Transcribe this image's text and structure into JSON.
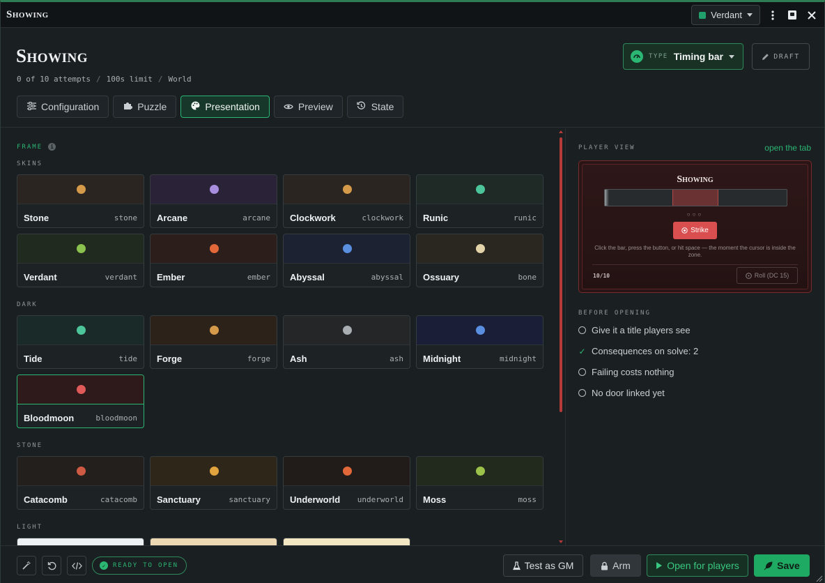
{
  "window": {
    "title": "Showing"
  },
  "theme_select": {
    "value": "Verdant",
    "swatch_color": "#22a06b"
  },
  "header": {
    "title": "Showing",
    "meta": {
      "attempts": "0 of 10 attempts",
      "limit": "100s limit",
      "scope": "World"
    },
    "type": {
      "label": "TYPE",
      "value": "Timing bar"
    },
    "draft_label": "DRAFT"
  },
  "tabs": [
    {
      "label": "Configuration",
      "icon": "sliders-icon"
    },
    {
      "label": "Puzzle",
      "icon": "puzzle-icon"
    },
    {
      "label": "Presentation",
      "icon": "palette-icon",
      "active": true
    },
    {
      "label": "Preview",
      "icon": "eye-icon"
    },
    {
      "label": "State",
      "icon": "history-icon"
    }
  ],
  "frame": {
    "label": "FRAME",
    "groups": [
      {
        "label": "SKINS",
        "items": [
          {
            "name": "Stone",
            "code": "stone",
            "bg": "#2a2520",
            "dot": "#d49a4a"
          },
          {
            "name": "Arcane",
            "code": "arcane",
            "bg": "#2a2236",
            "dot": "#a98ee0"
          },
          {
            "name": "Clockwork",
            "code": "clockwork",
            "bg": "#2a2520",
            "dot": "#d49a4a"
          },
          {
            "name": "Runic",
            "code": "runic",
            "bg": "#1f2a27",
            "dot": "#4cc59a"
          },
          {
            "name": "Verdant",
            "code": "verdant",
            "bg": "#212a1f",
            "dot": "#8bc24f"
          },
          {
            "name": "Ember",
            "code": "ember",
            "bg": "#2c1f1b",
            "dot": "#e2683a"
          },
          {
            "name": "Abyssal",
            "code": "abyssal",
            "bg": "#1c2232",
            "dot": "#5a8fe0"
          },
          {
            "name": "Ossuary",
            "code": "bone",
            "bg": "#2a2720",
            "dot": "#e3d3a8"
          }
        ]
      },
      {
        "label": "DARK",
        "items": [
          {
            "name": "Tide",
            "code": "tide",
            "bg": "#1a2a28",
            "dot": "#4cc59a"
          },
          {
            "name": "Forge",
            "code": "forge",
            "bg": "#2c2219",
            "dot": "#d49a4a"
          },
          {
            "name": "Ash",
            "code": "ash",
            "bg": "#242628",
            "dot": "#a9aeb2"
          },
          {
            "name": "Midnight",
            "code": "midnight",
            "bg": "#1a1e36",
            "dot": "#5a8fe0"
          },
          {
            "name": "Bloodmoon",
            "code": "bloodmoon",
            "bg": "#2e1a1b",
            "dot": "#e05a5a",
            "selected": true
          }
        ]
      },
      {
        "label": "STONE",
        "items": [
          {
            "name": "Catacomb",
            "code": "catacomb",
            "bg": "#221f1d",
            "dot": "#cf5a44"
          },
          {
            "name": "Sanctuary",
            "code": "sanctuary",
            "bg": "#2e2618",
            "dot": "#e0a33e"
          },
          {
            "name": "Underworld",
            "code": "underworld",
            "bg": "#211b1a",
            "dot": "#e2683a"
          },
          {
            "name": "Moss",
            "code": "moss",
            "bg": "#222a1e",
            "dot": "#9dc24a"
          }
        ]
      },
      {
        "label": "LIGHT",
        "items": [
          {
            "name": "",
            "code": "",
            "bg": "#eef1f3",
            "dot": "#1e7a4a"
          },
          {
            "name": "",
            "code": "",
            "bg": "#ecd9b3",
            "dot": "#6b4216"
          },
          {
            "name": "",
            "code": "",
            "bg": "#f3e6c2",
            "dot": "#5b3a14"
          }
        ]
      }
    ]
  },
  "player_view": {
    "label": "PLAYER VIEW",
    "link": "open the tab",
    "title": "Showing",
    "dots": "○○○",
    "strike_label": "Strike",
    "hint": "Click the bar, press the button, or hit space — the moment the cursor is inside the zone.",
    "count": "10/10",
    "roll_label": "Roll (DC 15)"
  },
  "before_opening": {
    "label": "BEFORE OPENING",
    "items": [
      {
        "text": "Give it a title players see",
        "done": false
      },
      {
        "text": "Consequences on solve: 2",
        "done": true
      },
      {
        "text": "Failing costs nothing",
        "done": false
      },
      {
        "text": "No door linked yet",
        "done": false
      }
    ]
  },
  "footer": {
    "status": "READY TO OPEN",
    "test_label": "Test as GM",
    "arm_label": "Arm",
    "open_label": "Open for players",
    "save_label": "Save"
  }
}
